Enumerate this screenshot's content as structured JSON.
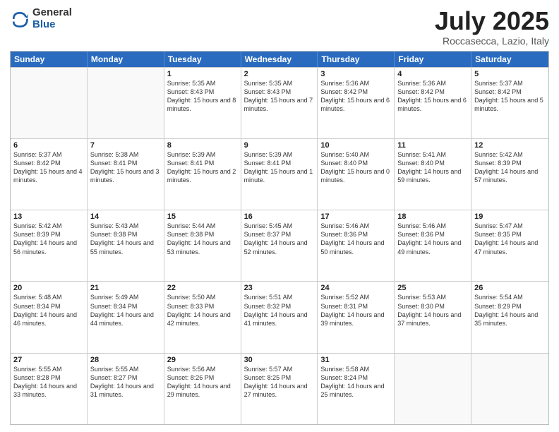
{
  "logo": {
    "general": "General",
    "blue": "Blue"
  },
  "header": {
    "title": "July 2025",
    "subtitle": "Roccasecca, Lazio, Italy"
  },
  "weekdays": [
    "Sunday",
    "Monday",
    "Tuesday",
    "Wednesday",
    "Thursday",
    "Friday",
    "Saturday"
  ],
  "weeks": [
    [
      {
        "day": "",
        "info": ""
      },
      {
        "day": "",
        "info": ""
      },
      {
        "day": "1",
        "info": "Sunrise: 5:35 AM\nSunset: 8:43 PM\nDaylight: 15 hours and 8 minutes."
      },
      {
        "day": "2",
        "info": "Sunrise: 5:35 AM\nSunset: 8:43 PM\nDaylight: 15 hours and 7 minutes."
      },
      {
        "day": "3",
        "info": "Sunrise: 5:36 AM\nSunset: 8:42 PM\nDaylight: 15 hours and 6 minutes."
      },
      {
        "day": "4",
        "info": "Sunrise: 5:36 AM\nSunset: 8:42 PM\nDaylight: 15 hours and 6 minutes."
      },
      {
        "day": "5",
        "info": "Sunrise: 5:37 AM\nSunset: 8:42 PM\nDaylight: 15 hours and 5 minutes."
      }
    ],
    [
      {
        "day": "6",
        "info": "Sunrise: 5:37 AM\nSunset: 8:42 PM\nDaylight: 15 hours and 4 minutes."
      },
      {
        "day": "7",
        "info": "Sunrise: 5:38 AM\nSunset: 8:41 PM\nDaylight: 15 hours and 3 minutes."
      },
      {
        "day": "8",
        "info": "Sunrise: 5:39 AM\nSunset: 8:41 PM\nDaylight: 15 hours and 2 minutes."
      },
      {
        "day": "9",
        "info": "Sunrise: 5:39 AM\nSunset: 8:41 PM\nDaylight: 15 hours and 1 minute."
      },
      {
        "day": "10",
        "info": "Sunrise: 5:40 AM\nSunset: 8:40 PM\nDaylight: 15 hours and 0 minutes."
      },
      {
        "day": "11",
        "info": "Sunrise: 5:41 AM\nSunset: 8:40 PM\nDaylight: 14 hours and 59 minutes."
      },
      {
        "day": "12",
        "info": "Sunrise: 5:42 AM\nSunset: 8:39 PM\nDaylight: 14 hours and 57 minutes."
      }
    ],
    [
      {
        "day": "13",
        "info": "Sunrise: 5:42 AM\nSunset: 8:39 PM\nDaylight: 14 hours and 56 minutes."
      },
      {
        "day": "14",
        "info": "Sunrise: 5:43 AM\nSunset: 8:38 PM\nDaylight: 14 hours and 55 minutes."
      },
      {
        "day": "15",
        "info": "Sunrise: 5:44 AM\nSunset: 8:38 PM\nDaylight: 14 hours and 53 minutes."
      },
      {
        "day": "16",
        "info": "Sunrise: 5:45 AM\nSunset: 8:37 PM\nDaylight: 14 hours and 52 minutes."
      },
      {
        "day": "17",
        "info": "Sunrise: 5:46 AM\nSunset: 8:36 PM\nDaylight: 14 hours and 50 minutes."
      },
      {
        "day": "18",
        "info": "Sunrise: 5:46 AM\nSunset: 8:36 PM\nDaylight: 14 hours and 49 minutes."
      },
      {
        "day": "19",
        "info": "Sunrise: 5:47 AM\nSunset: 8:35 PM\nDaylight: 14 hours and 47 minutes."
      }
    ],
    [
      {
        "day": "20",
        "info": "Sunrise: 5:48 AM\nSunset: 8:34 PM\nDaylight: 14 hours and 46 minutes."
      },
      {
        "day": "21",
        "info": "Sunrise: 5:49 AM\nSunset: 8:34 PM\nDaylight: 14 hours and 44 minutes."
      },
      {
        "day": "22",
        "info": "Sunrise: 5:50 AM\nSunset: 8:33 PM\nDaylight: 14 hours and 42 minutes."
      },
      {
        "day": "23",
        "info": "Sunrise: 5:51 AM\nSunset: 8:32 PM\nDaylight: 14 hours and 41 minutes."
      },
      {
        "day": "24",
        "info": "Sunrise: 5:52 AM\nSunset: 8:31 PM\nDaylight: 14 hours and 39 minutes."
      },
      {
        "day": "25",
        "info": "Sunrise: 5:53 AM\nSunset: 8:30 PM\nDaylight: 14 hours and 37 minutes."
      },
      {
        "day": "26",
        "info": "Sunrise: 5:54 AM\nSunset: 8:29 PM\nDaylight: 14 hours and 35 minutes."
      }
    ],
    [
      {
        "day": "27",
        "info": "Sunrise: 5:55 AM\nSunset: 8:28 PM\nDaylight: 14 hours and 33 minutes."
      },
      {
        "day": "28",
        "info": "Sunrise: 5:55 AM\nSunset: 8:27 PM\nDaylight: 14 hours and 31 minutes."
      },
      {
        "day": "29",
        "info": "Sunrise: 5:56 AM\nSunset: 8:26 PM\nDaylight: 14 hours and 29 minutes."
      },
      {
        "day": "30",
        "info": "Sunrise: 5:57 AM\nSunset: 8:25 PM\nDaylight: 14 hours and 27 minutes."
      },
      {
        "day": "31",
        "info": "Sunrise: 5:58 AM\nSunset: 8:24 PM\nDaylight: 14 hours and 25 minutes."
      },
      {
        "day": "",
        "info": ""
      },
      {
        "day": "",
        "info": ""
      }
    ]
  ]
}
